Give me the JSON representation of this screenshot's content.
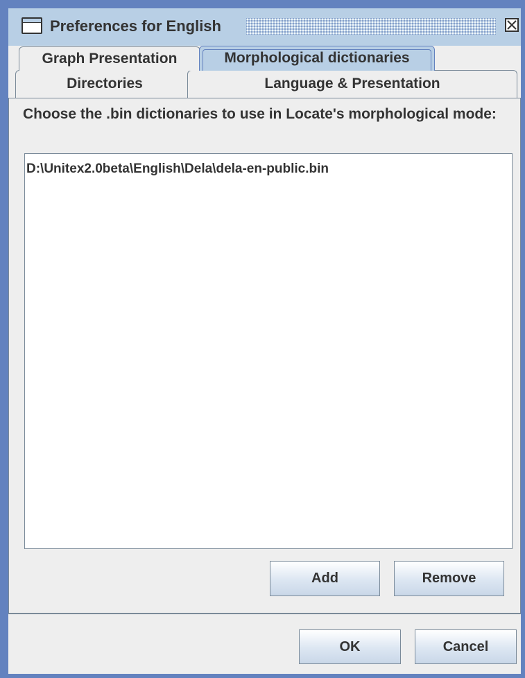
{
  "window": {
    "title": "Preferences for English",
    "app_icon": "window-icon",
    "close_icon": "close-icon"
  },
  "tabs": {
    "row1": [
      {
        "label": "Graph Presentation",
        "selected": false
      },
      {
        "label": "Morphological dictionaries",
        "selected": true
      }
    ],
    "row2": [
      {
        "label": "Directories",
        "selected": false
      },
      {
        "label": "Language & Presentation",
        "selected": false
      }
    ]
  },
  "panel": {
    "prompt": "Choose the .bin dictionaries to use in Locate's morphological mode:",
    "dictionaries": [
      "D:\\Unitex2.0beta\\English\\Dela\\dela-en-public.bin"
    ],
    "add_label": "Add",
    "remove_label": "Remove"
  },
  "footer": {
    "ok_label": "OK",
    "cancel_label": "Cancel"
  },
  "colors": {
    "frame": "#6382bf",
    "titlebar": "#b8cfe5",
    "background": "#eeeeee",
    "text": "#333333"
  }
}
